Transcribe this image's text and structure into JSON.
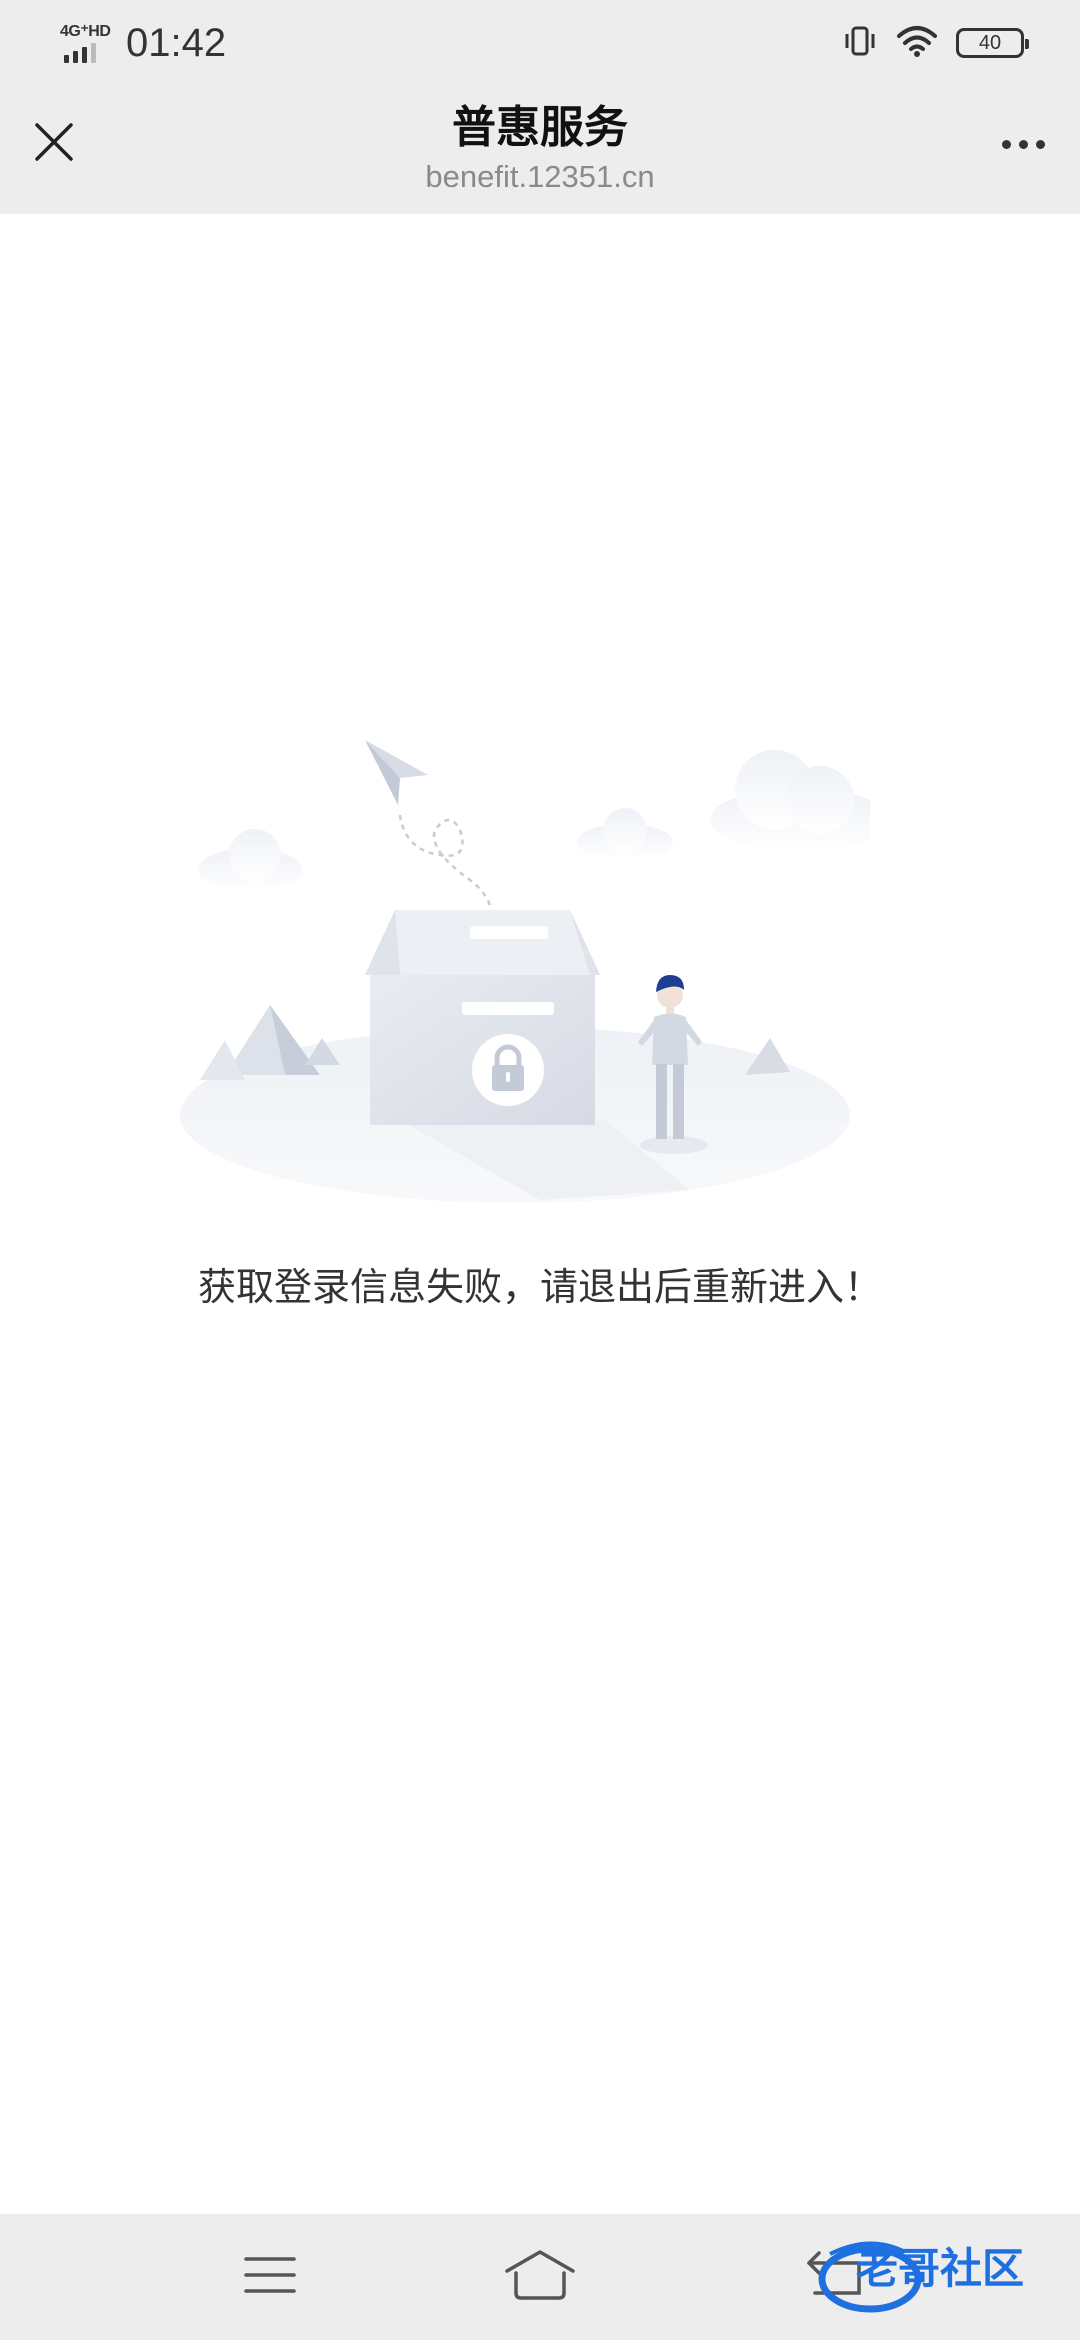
{
  "status_bar": {
    "network": "4G⁺HD",
    "time": "01:42",
    "battery": "40",
    "icons": [
      "vibrate-icon",
      "wifi-icon",
      "battery-icon"
    ]
  },
  "header": {
    "title": "普惠服务",
    "url": "benefit.12351.cn",
    "close_icon": "close-icon",
    "more_icon": "more-icon"
  },
  "main": {
    "illustration": "login-failed-illustration",
    "message": "获取登录信息失败，请退出后重新进入！"
  },
  "nav_bar": {
    "icons": [
      "menu-icon",
      "home-icon",
      "back-icon"
    ],
    "watermark": "老哥社区"
  },
  "colors": {
    "bar_background": "#ededed",
    "page_background": "#ffffff",
    "watermark": "#1e6fe0"
  }
}
